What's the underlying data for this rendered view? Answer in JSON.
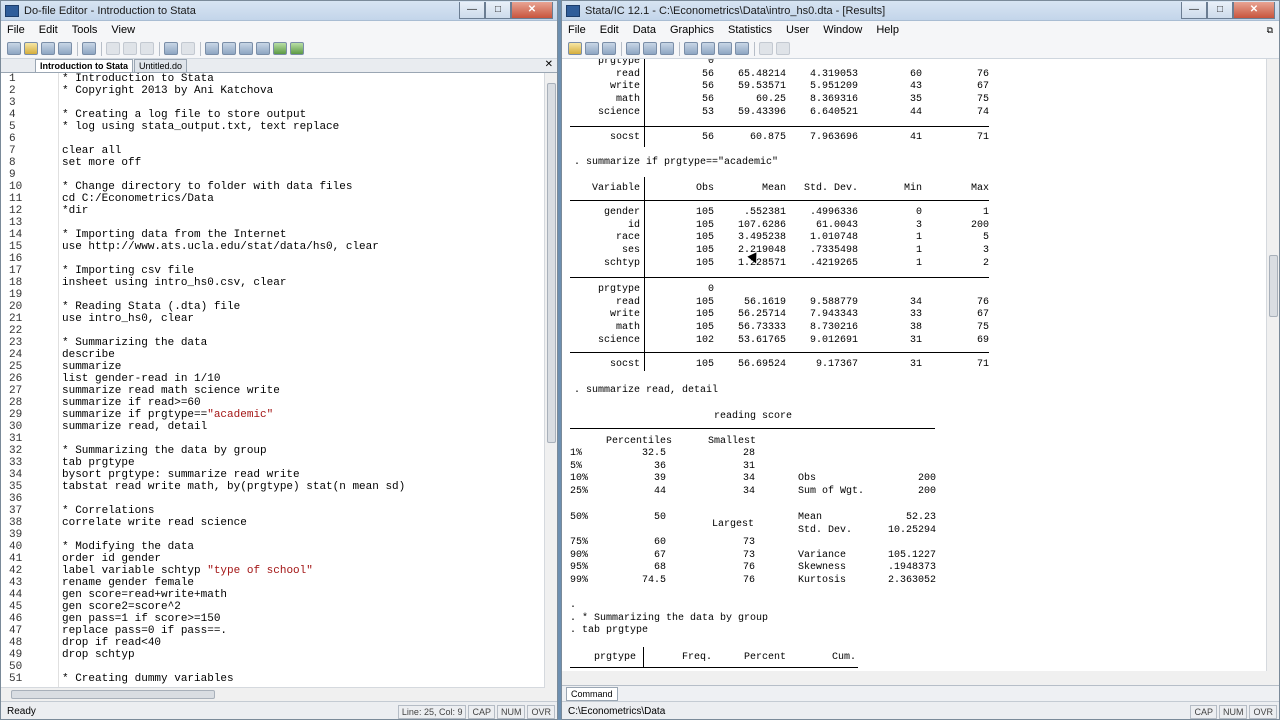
{
  "dofile": {
    "title": "Do-file Editor - Introduction to Stata",
    "menu": [
      "File",
      "Edit",
      "Tools",
      "View"
    ],
    "tabs": [
      "Introduction to Stata",
      "Untitled.do"
    ],
    "lines": [
      {
        "n": "1",
        "t": "* Introduction to Stata",
        "k": "cm"
      },
      {
        "n": "2",
        "t": "* Copyright 2013 by Ani Katchova",
        "k": "cm"
      },
      {
        "n": "3",
        "t": "",
        "k": ""
      },
      {
        "n": "4",
        "t": "* Creating a log file to store output",
        "k": "cm"
      },
      {
        "n": "5",
        "t": "* log using stata_output.txt, text replace",
        "k": "cm"
      },
      {
        "n": "6",
        "t": "",
        "k": ""
      },
      {
        "n": "7",
        "t": "clear all",
        "k": ""
      },
      {
        "n": "8",
        "t": "set more off",
        "k": ""
      },
      {
        "n": "9",
        "t": "",
        "k": ""
      },
      {
        "n": "10",
        "t": "* Change directory to folder with data files",
        "k": "cm"
      },
      {
        "n": "11",
        "t": "cd C:/Econometrics/Data",
        "k": ""
      },
      {
        "n": "12",
        "t": "*dir",
        "k": "cm"
      },
      {
        "n": "13",
        "t": "",
        "k": ""
      },
      {
        "n": "14",
        "t": "* Importing data from the Internet",
        "k": "cm"
      },
      {
        "n": "15",
        "t": "use http://www.ats.ucla.edu/stat/data/hs0, clear",
        "k": ""
      },
      {
        "n": "16",
        "t": "",
        "k": ""
      },
      {
        "n": "17",
        "t": "* Importing csv file",
        "k": "cm"
      },
      {
        "n": "18",
        "t": "insheet using intro_hs0.csv, clear",
        "k": ""
      },
      {
        "n": "19",
        "t": "",
        "k": ""
      },
      {
        "n": "20",
        "t": "* Reading Stata (.dta) file",
        "k": "cm"
      },
      {
        "n": "21",
        "t": "use intro_hs0, clear",
        "k": ""
      },
      {
        "n": "22",
        "t": "",
        "k": ""
      },
      {
        "n": "23",
        "t": "* Summarizing the data",
        "k": "cm"
      },
      {
        "n": "24",
        "t": "describe",
        "k": ""
      },
      {
        "n": "25",
        "t": "summarize",
        "k": ""
      },
      {
        "n": "26",
        "t": "list gender-read in 1/10",
        "k": ""
      },
      {
        "n": "27",
        "t": "summarize read math science write",
        "k": ""
      },
      {
        "n": "28",
        "t": "summarize if read>=60",
        "k": ""
      },
      {
        "n": "29",
        "t": "summarize if prgtype==\"academic\"",
        "k": ""
      },
      {
        "n": "30",
        "t": "summarize read, detail",
        "k": ""
      },
      {
        "n": "31",
        "t": "",
        "k": ""
      },
      {
        "n": "32",
        "t": "* Summarizing the data by group",
        "k": "cm"
      },
      {
        "n": "33",
        "t": "tab prgtype",
        "k": ""
      },
      {
        "n": "34",
        "t": "bysort prgtype: summarize read write",
        "k": ""
      },
      {
        "n": "35",
        "t": "tabstat read write math, by(prgtype) stat(n mean sd)",
        "k": ""
      },
      {
        "n": "36",
        "t": "",
        "k": ""
      },
      {
        "n": "37",
        "t": "* Correlations",
        "k": "cm"
      },
      {
        "n": "38",
        "t": "correlate write read science",
        "k": ""
      },
      {
        "n": "39",
        "t": "",
        "k": ""
      },
      {
        "n": "40",
        "t": "* Modifying the data",
        "k": "cm"
      },
      {
        "n": "41",
        "t": "order id gender",
        "k": ""
      },
      {
        "n": "42",
        "t": "label variable schtyp \"type of school\"",
        "k": ""
      },
      {
        "n": "43",
        "t": "rename gender female",
        "k": ""
      },
      {
        "n": "44",
        "t": "gen score=read+write+math",
        "k": ""
      },
      {
        "n": "45",
        "t": "gen score2=score^2",
        "k": ""
      },
      {
        "n": "46",
        "t": "gen pass=1 if score>=150",
        "k": ""
      },
      {
        "n": "47",
        "t": "replace pass=0 if pass==.",
        "k": ""
      },
      {
        "n": "48",
        "t": "drop if read<40",
        "k": ""
      },
      {
        "n": "49",
        "t": "drop schtyp",
        "k": ""
      },
      {
        "n": "50",
        "t": "",
        "k": ""
      },
      {
        "n": "51",
        "t": "* Creating dummy variables",
        "k": "cm"
      }
    ],
    "status": {
      "ready": "Ready",
      "pos": "Line: 25, Col: 9",
      "cap": "CAP",
      "num": "NUM",
      "ovr": "OVR"
    }
  },
  "results": {
    "title": "Stata/IC 12.1 - C:\\Econometrics\\Data\\intro_hs0.dta - [Results]",
    "menu": [
      "File",
      "Edit",
      "Data",
      "Graphics",
      "Statistics",
      "User",
      "Window",
      "Help"
    ],
    "top_rows": [
      {
        "var": "prgtype",
        "obs": "0",
        "mean": "",
        "sd": "",
        "min": "",
        "max": ""
      },
      {
        "var": "read",
        "obs": "56",
        "mean": "65.48214",
        "sd": "4.319053",
        "min": "60",
        "max": "76"
      },
      {
        "var": "write",
        "obs": "56",
        "mean": "59.53571",
        "sd": "5.951209",
        "min": "43",
        "max": "67"
      },
      {
        "var": "math",
        "obs": "56",
        "mean": "60.25",
        "sd": "8.369316",
        "min": "35",
        "max": "75"
      },
      {
        "var": "science",
        "obs": "53",
        "mean": "59.43396",
        "sd": "6.640521",
        "min": "44",
        "max": "74"
      }
    ],
    "top_socst": {
      "var": "socst",
      "obs": "56",
      "mean": "60.875",
      "sd": "7.963696",
      "min": "41",
      "max": "71"
    },
    "cmd1": ". summarize if prgtype==\"academic\"",
    "headers": {
      "var": "Variable",
      "obs": "Obs",
      "mean": "Mean",
      "sd": "Std. Dev.",
      "min": "Min",
      "max": "Max"
    },
    "block1": [
      {
        "var": "gender",
        "obs": "105",
        "mean": ".552381",
        "sd": ".4996336",
        "min": "0",
        "max": "1"
      },
      {
        "var": "id",
        "obs": "105",
        "mean": "107.6286",
        "sd": "61.0043",
        "min": "3",
        "max": "200"
      },
      {
        "var": "race",
        "obs": "105",
        "mean": "3.495238",
        "sd": "1.010748",
        "min": "1",
        "max": "5"
      },
      {
        "var": "ses",
        "obs": "105",
        "mean": "2.219048",
        "sd": ".7335498",
        "min": "1",
        "max": "3"
      },
      {
        "var": "schtyp",
        "obs": "105",
        "mean": "1.228571",
        "sd": ".4219265",
        "min": "1",
        "max": "2"
      }
    ],
    "block2": [
      {
        "var": "prgtype",
        "obs": "0",
        "mean": "",
        "sd": "",
        "min": "",
        "max": ""
      },
      {
        "var": "read",
        "obs": "105",
        "mean": "56.1619",
        "sd": "9.588779",
        "min": "34",
        "max": "76"
      },
      {
        "var": "write",
        "obs": "105",
        "mean": "56.25714",
        "sd": "7.943343",
        "min": "33",
        "max": "67"
      },
      {
        "var": "math",
        "obs": "105",
        "mean": "56.73333",
        "sd": "8.730216",
        "min": "38",
        "max": "75"
      },
      {
        "var": "science",
        "obs": "102",
        "mean": "53.61765",
        "sd": "9.012691",
        "min": "31",
        "max": "69"
      }
    ],
    "socst": {
      "var": "socst",
      "obs": "105",
      "mean": "56.69524",
      "sd": "9.17367",
      "min": "31",
      "max": "71"
    },
    "cmd2": ". summarize read, detail",
    "detail_title": "reading score",
    "detail_headers": {
      "pct": "Percentiles",
      "smallest": "Smallest",
      "largest": "Largest"
    },
    "pct_rows_a": [
      {
        "p": "1%",
        "v": "32.5",
        "s": "28",
        "lbl": "",
        "val": ""
      },
      {
        "p": "5%",
        "v": "36",
        "s": "31",
        "lbl": "",
        "val": ""
      },
      {
        "p": "10%",
        "v": "39",
        "s": "34",
        "lbl": "Obs",
        "val": "200"
      },
      {
        "p": "25%",
        "v": "44",
        "s": "34",
        "lbl": "Sum of Wgt.",
        "val": "200"
      }
    ],
    "median": {
      "p": "50%",
      "v": "50",
      "lbl": "Mean",
      "val": "52.23"
    },
    "sd_row": {
      "lbl": "Std. Dev.",
      "val": "10.25294"
    },
    "pct_rows_b": [
      {
        "p": "75%",
        "v": "60",
        "s": "73",
        "lbl": "",
        "val": ""
      },
      {
        "p": "90%",
        "v": "67",
        "s": "73",
        "lbl": "Variance",
        "val": "105.1227"
      },
      {
        "p": "95%",
        "v": "68",
        "s": "76",
        "lbl": "Skewness",
        "val": ".1948373"
      },
      {
        "p": "99%",
        "v": "74.5",
        "s": "76",
        "lbl": "Kurtosis",
        "val": "2.363052"
      }
    ],
    "tail_lines": [
      ".",
      ". * Summarizing the data by group",
      ". tab prgtype"
    ],
    "tab_headers": {
      "var": "prgtype",
      "freq": "Freq.",
      "pct": "Percent",
      "cum": "Cum."
    },
    "command_tab": "Command",
    "status_path": "C:\\Econometrics\\Data",
    "status_cap": "CAP",
    "status_num": "NUM",
    "status_ovr": "OVR"
  }
}
